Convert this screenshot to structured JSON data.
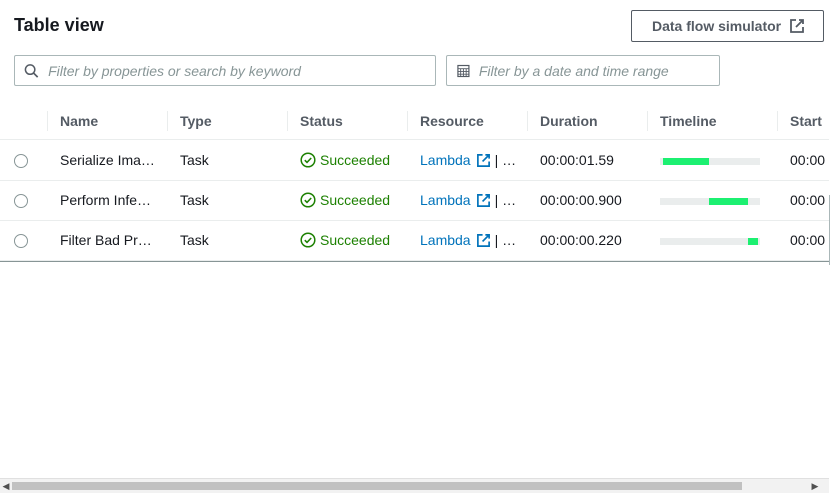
{
  "panel": {
    "title": "Table view",
    "simulator_button_label": "Data flow simulator"
  },
  "filters": {
    "search_placeholder": "Filter by properties or search by keyword",
    "date_placeholder": "Filter by a date and time range"
  },
  "table": {
    "columns": [
      "Name",
      "Type",
      "Status",
      "Resource",
      "Duration",
      "Timeline",
      "Start"
    ],
    "rows": [
      {
        "name": "Serialize Ima…",
        "type": "Task",
        "status": "Succeeded",
        "resource_link": "Lambda",
        "resource_rest": "| …",
        "duration": "00:00:01.59",
        "timeline": {
          "start": 0.03,
          "end": 0.49
        },
        "start": "00:00"
      },
      {
        "name": "Perform Infe…",
        "type": "Task",
        "status": "Succeeded",
        "resource_link": "Lambda",
        "resource_rest": "| …",
        "duration": "00:00:00.900",
        "timeline": {
          "start": 0.49,
          "end": 0.88
        },
        "start": "00:00"
      },
      {
        "name": "Filter Bad Pr…",
        "type": "Task",
        "status": "Succeeded",
        "resource_link": "Lambda",
        "resource_rest": "| …",
        "duration": "00:00:00.220",
        "timeline": {
          "start": 0.88,
          "end": 0.98
        },
        "start": "00:00"
      }
    ]
  },
  "colors": {
    "success": "#1d8102",
    "link": "#0073bb",
    "timeline_bar": "#1cf071",
    "timeline_track": "#eaeded"
  },
  "icons": {
    "external_link": "external-link-icon",
    "search": "search-icon",
    "calendar": "calendar-icon",
    "status": "check-circle-icon"
  }
}
